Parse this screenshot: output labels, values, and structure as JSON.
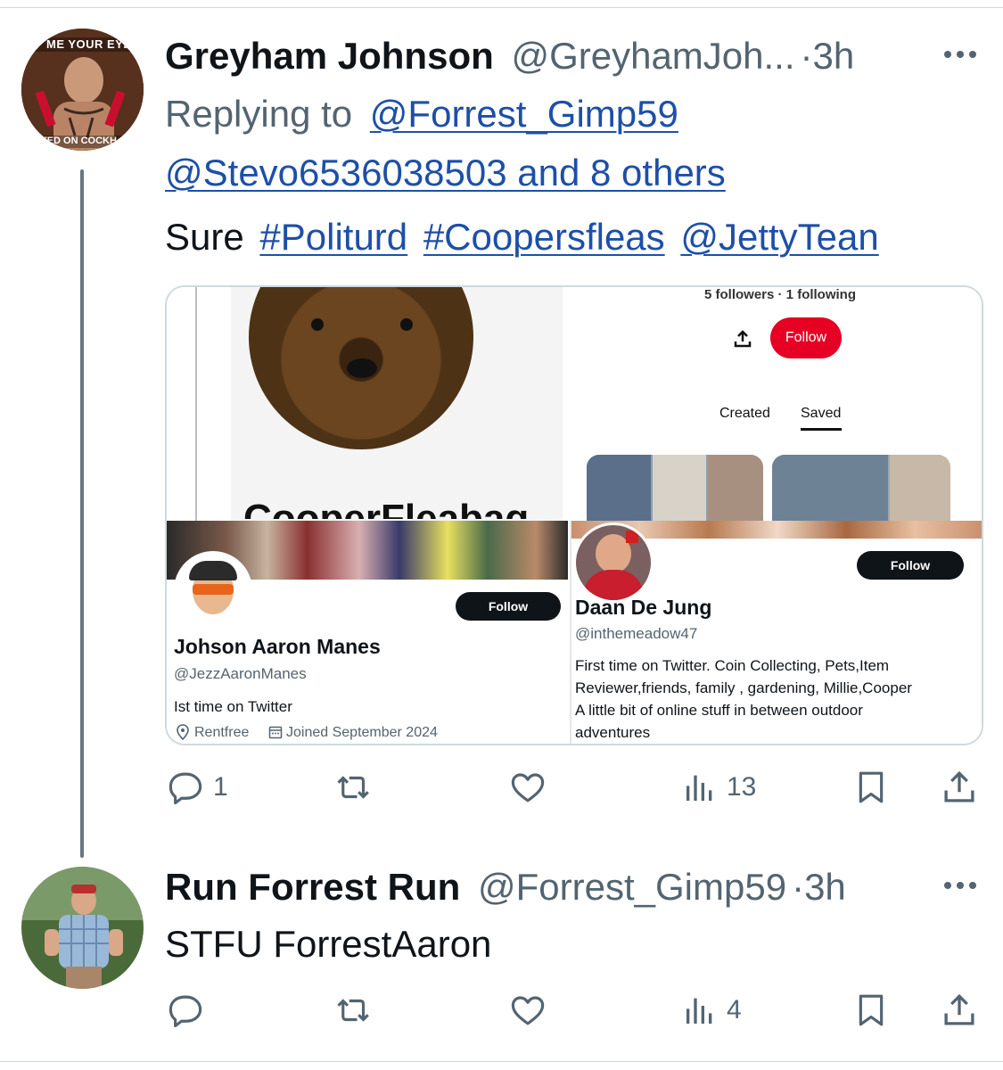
{
  "tweets": [
    {
      "name": "Greyham Johnson",
      "handle": "@GreyhamJoh...",
      "dot": "·",
      "time": "3h",
      "avatar_text_top": "ME YOUR EYE",
      "avatar_text_bottom": "TED ON COCKH",
      "replying_prefix": "Replying to",
      "reply_to_1": "@Forrest_Gimp59",
      "reply_to_2": "@Stevo6536038503 and 8 others",
      "body_word": "Sure",
      "body_tag_1": "#Politurd",
      "body_tag_2": "#Coopersfleas",
      "body_mention": "@JettyTean",
      "stats": {
        "replies": "1",
        "reposts": "",
        "likes": "",
        "views": "13"
      }
    },
    {
      "name": "Run Forrest Run",
      "handle": "@Forrest_Gimp59",
      "dot": "·",
      "time": "3h",
      "body": "STFU ForrestAaron",
      "stats": {
        "replies": "",
        "reposts": "",
        "likes": "",
        "views": "4"
      }
    }
  ],
  "media": {
    "pinterest": {
      "stats": "5 followers · 1 following",
      "follow": "Follow",
      "tab_created": "Created",
      "tab_saved": "Saved",
      "name_partial": "CooperFleabag"
    },
    "profile_left": {
      "follow": "Follow",
      "name": "Johson Aaron Manes",
      "handle": "@JezzAaronManes",
      "bio": "Ist time on Twitter",
      "location": "Rentfree",
      "joined": "Joined September 2024"
    },
    "profile_right": {
      "follow": "Follow",
      "name": "Daan De Jung",
      "handle": "@inthemeadow47",
      "bio_1": "First time on Twitter. Coin Collecting, Pets,Item",
      "bio_2": "Reviewer,friends, family , gardening, Millie,Cooper",
      "bio_3": "A little bit of online stuff in between outdoor",
      "bio_4": "adventures"
    }
  },
  "icons": {
    "reply": "reply-icon",
    "repost": "repost-icon",
    "like": "like-icon",
    "views": "views-icon",
    "bookmark": "bookmark-icon",
    "share": "share-icon",
    "more": "more-icon"
  },
  "colors": {
    "link": "#1d4fa8",
    "secondary_text": "#536471",
    "pinterest_red": "#e60023",
    "x_black": "#0f1419"
  }
}
